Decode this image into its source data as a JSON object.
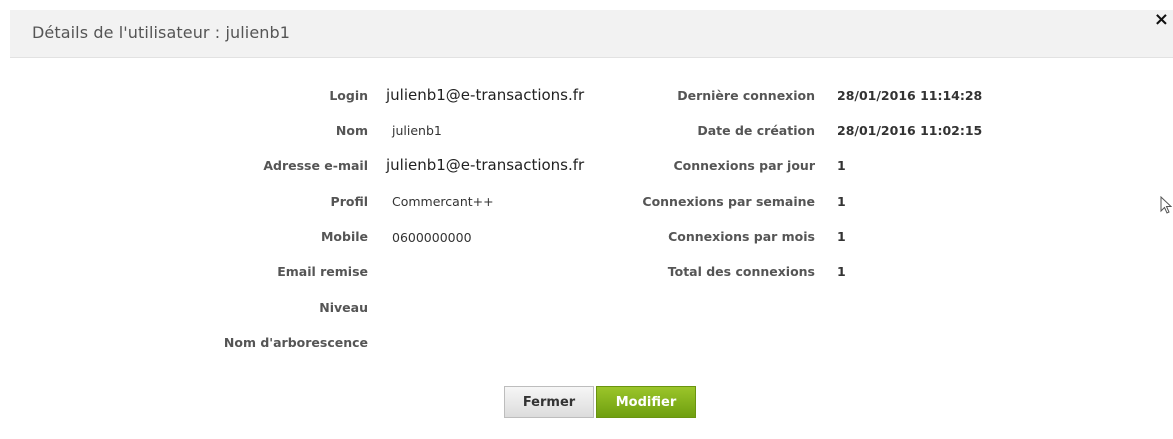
{
  "dialog": {
    "title": "Détails de l'utilisateur : julienb1",
    "close_symbol": "×"
  },
  "left_fields": [
    {
      "label": "Login",
      "value": "julienb1@e-transactions.fr"
    },
    {
      "label": "Nom",
      "value": "julienb1"
    },
    {
      "label": "Adresse e-mail",
      "value": "julienb1@e-transactions.fr"
    },
    {
      "label": "Profil",
      "value": "Commercant++"
    },
    {
      "label": "Mobile",
      "value": "0600000000"
    },
    {
      "label": "Email remise",
      "value": ""
    },
    {
      "label": "Niveau",
      "value": ""
    },
    {
      "label": "Nom d'arborescence",
      "value": ""
    }
  ],
  "right_fields": [
    {
      "label": "Dernière connexion",
      "value": "28/01/2016 11:14:28"
    },
    {
      "label": "Date de création",
      "value": "28/01/2016 11:02:15"
    },
    {
      "label": "Connexions par jour",
      "value": "1"
    },
    {
      "label": "Connexions par semaine",
      "value": "1"
    },
    {
      "label": "Connexions par mois",
      "value": "1"
    },
    {
      "label": "Total des connexions",
      "value": "1"
    }
  ],
  "buttons": {
    "close_label": "Fermer",
    "edit_label": "Modifier"
  },
  "colors": {
    "edit_button": "#7fad16",
    "titlebar": "#f2f2f2"
  },
  "icons": {
    "close": "close-icon",
    "cursor": "mouse-pointer-icon"
  }
}
